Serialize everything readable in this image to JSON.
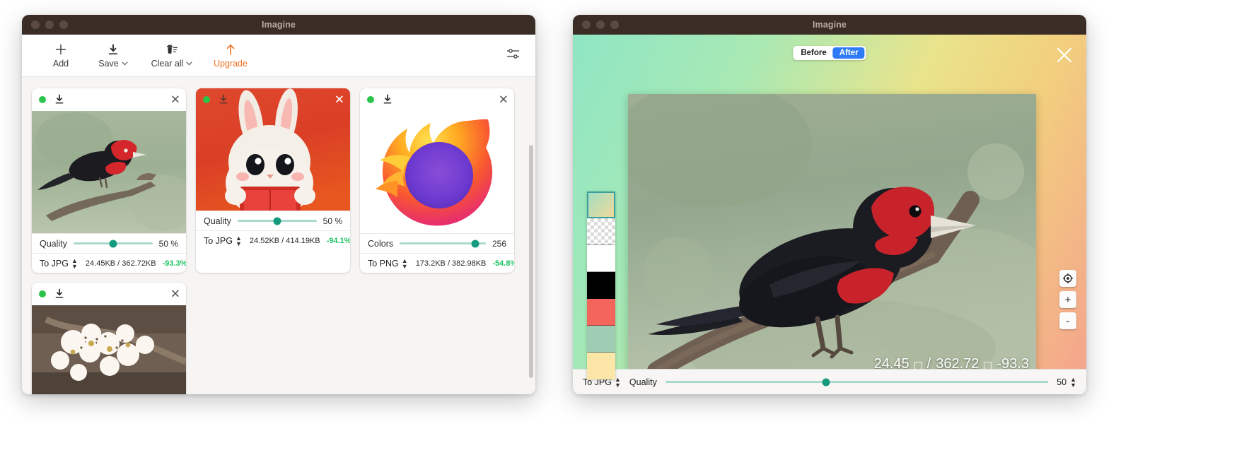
{
  "left_window": {
    "title": "Imagine",
    "toolbar": {
      "add_label": "Add",
      "save_label": "Save",
      "clear_label": "Clear all",
      "upgrade_label": "Upgrade",
      "settings_icon": "sliders-icon",
      "caret": "⌄"
    },
    "cards": [
      {
        "status": "done",
        "thumb": "bird-on-branch",
        "slider_label": "Quality",
        "slider_value": "50 %",
        "slider_pct": 50,
        "format": "To JPG",
        "sizes": "24.45KB / 362.72KB",
        "savings": "-93.3%"
      },
      {
        "status": "done",
        "thumb": "rabbit-reading-book",
        "slider_label": "Quality",
        "slider_value": "50 %",
        "slider_pct": 50,
        "format": "To JPG",
        "sizes": "24.52KB / 414.19KB",
        "savings": "-94.1%"
      },
      {
        "status": "done",
        "thumb": "firefox-logo",
        "slider_label": "Colors",
        "slider_value": "256",
        "slider_pct": 88,
        "format": "To PNG",
        "sizes": "173.2KB / 382.98KB",
        "savings": "-54.8%"
      },
      {
        "status": "done",
        "thumb": "white-blossoms",
        "slider_label": "",
        "slider_value": "",
        "slider_pct": 0,
        "format": "",
        "sizes": "",
        "savings": ""
      }
    ]
  },
  "right_window": {
    "title": "Imagine",
    "compare": {
      "before_label": "Before",
      "after_label": "After",
      "active": "After"
    },
    "close_icon": "close-icon",
    "preview_image": "bird-on-branch",
    "stats": {
      "compressed": "24.45",
      "separator": "/",
      "original": "362.72",
      "savings": "-93.3"
    },
    "palette": [
      "#f5d8a0",
      "#ffffff",
      "#ffffff",
      "#000000",
      "#f4655c",
      "#9fcdb3",
      "#fbe6a8"
    ],
    "zoom_controls": {
      "fit_icon": "target-icon",
      "zoom_in": "+",
      "zoom_out": "-"
    },
    "bottom": {
      "format": "To JPG",
      "quality_label": "Quality",
      "quality_value": "50",
      "quality_pct": 50
    }
  },
  "colors": {
    "accent_orange": "#ef7023",
    "slider_green": "#169a7d",
    "savings_green": "#1ec462",
    "status_green": "#2bc44a",
    "toggle_blue": "#2f7bf6",
    "titlebar": "#3a2d26"
  }
}
